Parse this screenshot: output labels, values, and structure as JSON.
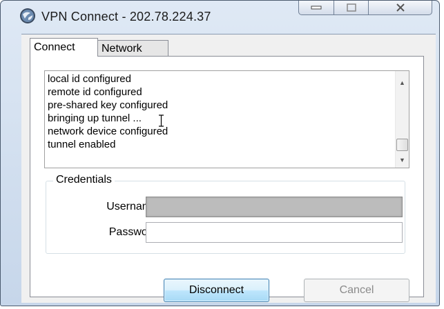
{
  "window": {
    "title": "VPN Connect - 202.78.224.37",
    "app_icon": "vpn-globe-icon",
    "caption_buttons": [
      "minimize-icon",
      "maximize-icon",
      "close-icon"
    ]
  },
  "tabs": [
    {
      "label": "Connect",
      "selected": true
    },
    {
      "label": "Network",
      "selected": false
    }
  ],
  "log": {
    "lines": [
      "local id configured",
      "remote id configured",
      "pre-shared key configured",
      "bringing up tunnel ...",
      "network device configured",
      "tunnel enabled"
    ]
  },
  "credentials": {
    "legend": "Credentials",
    "username_label": "Username",
    "username_value": "",
    "password_label": "Password",
    "password_value": ""
  },
  "buttons": {
    "disconnect": "Disconnect",
    "cancel": "Cancel"
  },
  "colors": {
    "titlebar": "#c6d6ea",
    "focused_button_border": "#3c7fb1",
    "disabled_text": "#8a8a8a"
  }
}
